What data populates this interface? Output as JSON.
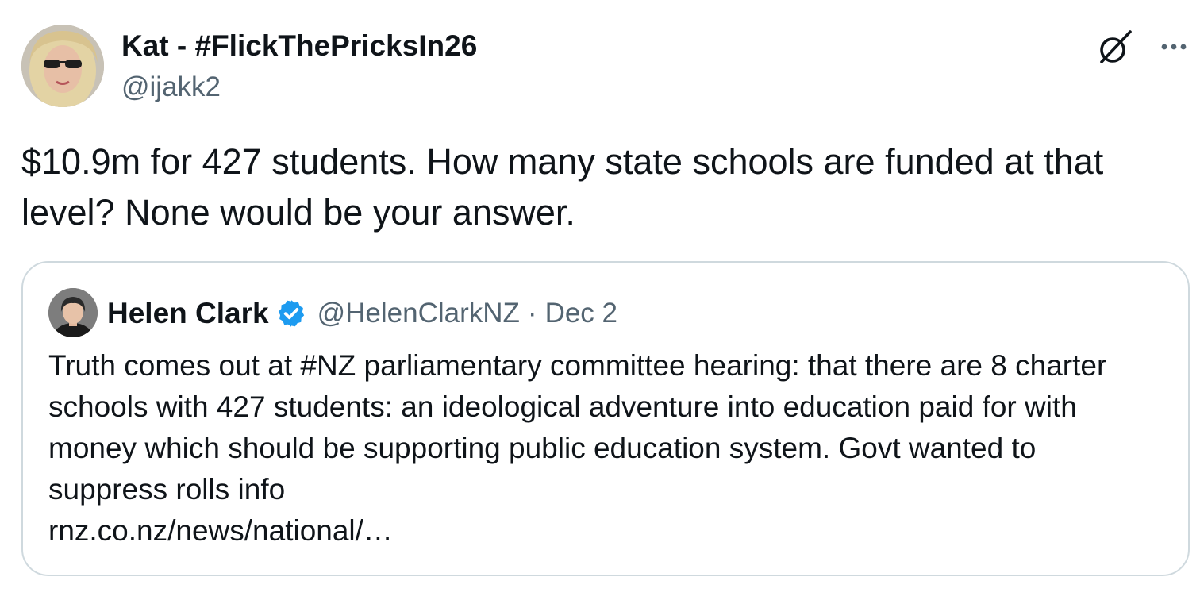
{
  "tweet": {
    "author": {
      "display_name": "Kat - #FlickThePricksIn26",
      "handle": "@ijakk2",
      "avatar": "profile-photo"
    },
    "text": "$10.9m for 427 students. How many state schools are funded at that level? None would be your answer.",
    "actions": {
      "grok_icon": "grok-icon",
      "more_icon": "more-horizontal-icon"
    }
  },
  "quoted_tweet": {
    "author": {
      "display_name": "Helen Clark",
      "handle": "@HelenClarkNZ",
      "verified_icon": "verified-badge-icon",
      "avatar": "profile-photo"
    },
    "separator": "·",
    "date": "Dec 2",
    "text": "Truth comes out at #NZ parliamentary committee hearing: that there are 8 charter schools with 427 students: an ideological adventure into education paid for with money which should be supporting public education system. Govt wanted to suppress rolls info",
    "link": "rnz.co.nz/news/national/…"
  },
  "colors": {
    "text_primary": "#0f1419",
    "text_secondary": "#536471",
    "border": "#cfd9de",
    "verified_blue": "#1d9bf0"
  }
}
